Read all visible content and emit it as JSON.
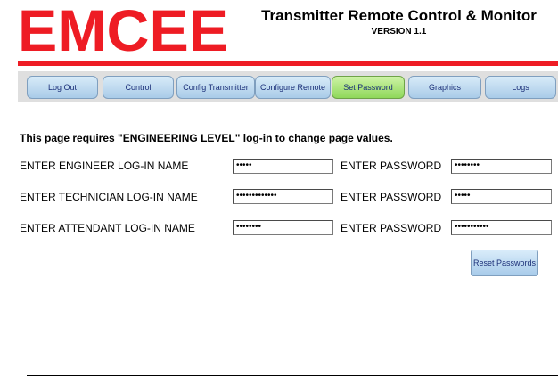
{
  "brand": {
    "logo_text": "EMCEE",
    "logo_color": "#ee1c24"
  },
  "header": {
    "title": "Transmitter Remote Control & Monitor",
    "version": "VERSION 1.1"
  },
  "nav": {
    "items": [
      {
        "label": "Log Out"
      },
      {
        "label": "Control"
      },
      {
        "label": "Config Transmitter"
      },
      {
        "label": "Configure Remote"
      },
      {
        "label": "Set Password"
      },
      {
        "label": "Graphics"
      },
      {
        "label": "Logs"
      }
    ],
    "active_index": 4
  },
  "notice": "This page requires \"ENGINEERING LEVEL\" log-in to change page values.",
  "rows": [
    {
      "name_label": "ENTER ENGINEER LOG-IN NAME",
      "name_value": "•••••",
      "pw_label": "ENTER PASSWORD",
      "pw_value": "••••••••"
    },
    {
      "name_label": "ENTER TECHNICIAN LOG-IN NAME",
      "name_value": "•••••••••••••",
      "pw_label": "ENTER PASSWORD",
      "pw_value": "•••••"
    },
    {
      "name_label": "ENTER ATTENDANT LOG-IN NAME",
      "name_value": "••••••••",
      "pw_label": "ENTER PASSWORD",
      "pw_value": "•••••••••••"
    }
  ],
  "reset_button": "Reset Passwords",
  "colors": {
    "accent_red": "#ee1c24",
    "nav_blue": "#a9cbe8",
    "nav_active_green": "#8fd85a",
    "nav_text": "#1b2f78"
  }
}
